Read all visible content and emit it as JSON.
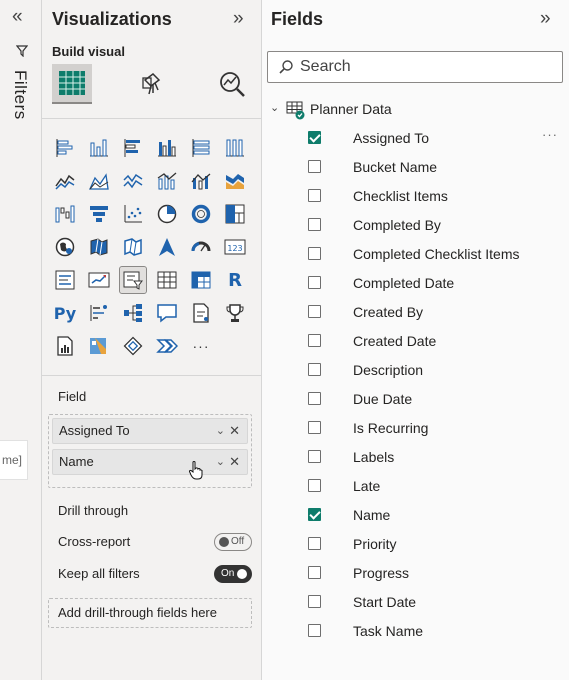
{
  "filters": {
    "label": "Filters",
    "collapse_glyph": "«",
    "fragment": "me]"
  },
  "visualizations": {
    "title": "Visualizations",
    "expand_glyph": "»",
    "subtitle": "Build visual",
    "field_label": "Field",
    "field_wells": [
      {
        "label": "Assigned To"
      },
      {
        "label": "Name"
      }
    ],
    "drill_through": {
      "title": "Drill through",
      "cross_report": {
        "label": "Cross-report",
        "state": "Off"
      },
      "keep_all_filters": {
        "label": "Keep all filters",
        "state": "On"
      },
      "add_text": "Add drill-through fields here"
    },
    "visual_grid": {
      "r_label": "R",
      "py_label": "Py",
      "more_label": "···",
      "kpi_label": "123"
    }
  },
  "fields": {
    "title": "Fields",
    "expand_glyph": "»",
    "search": {
      "placeholder": "Search"
    },
    "table": {
      "name": "Planner Data",
      "more_label": "···",
      "columns": [
        {
          "name": "Assigned To",
          "checked": true
        },
        {
          "name": "Bucket Name",
          "checked": false
        },
        {
          "name": "Checklist Items",
          "checked": false
        },
        {
          "name": "Completed By",
          "checked": false
        },
        {
          "name": "Completed Checklist Items",
          "checked": false
        },
        {
          "name": "Completed Date",
          "checked": false
        },
        {
          "name": "Created By",
          "checked": false
        },
        {
          "name": "Created Date",
          "checked": false
        },
        {
          "name": "Description",
          "checked": false
        },
        {
          "name": "Due Date",
          "checked": false
        },
        {
          "name": "Is Recurring",
          "checked": false
        },
        {
          "name": "Labels",
          "checked": false
        },
        {
          "name": "Late",
          "checked": false
        },
        {
          "name": "Name",
          "checked": true
        },
        {
          "name": "Priority",
          "checked": false
        },
        {
          "name": "Progress",
          "checked": false
        },
        {
          "name": "Start Date",
          "checked": false
        },
        {
          "name": "Task Name",
          "checked": false
        }
      ]
    }
  },
  "colors": {
    "accent": "#0e7c6b",
    "chart_blue": "#1f63ad",
    "chart_light": "#5b9bd5",
    "chart_orange": "#e8a33d"
  }
}
